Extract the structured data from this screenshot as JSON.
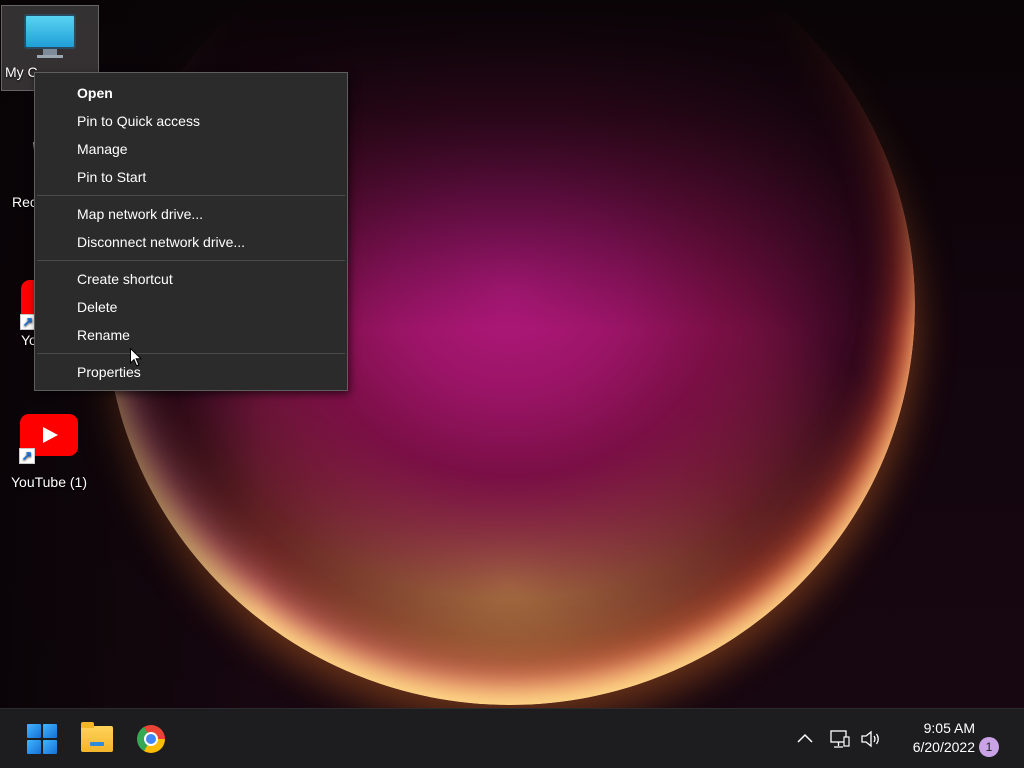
{
  "desktop": {
    "icons": [
      {
        "label": "My C",
        "icon": "monitor-icon"
      },
      {
        "label": "Rec",
        "icon": "recycle-bin-icon"
      },
      {
        "label": "Yo",
        "icon": "youtube-icon"
      },
      {
        "label": "YouTube (1)",
        "icon": "youtube-icon"
      }
    ]
  },
  "context_menu": {
    "items": [
      {
        "label": "Open",
        "bold": true
      },
      {
        "label": "Pin to Quick access"
      },
      {
        "label": "Manage"
      },
      {
        "label": "Pin to Start"
      },
      {
        "label": "Map network drive..."
      },
      {
        "label": "Disconnect network drive..."
      },
      {
        "label": "Create shortcut"
      },
      {
        "label": "Delete"
      },
      {
        "label": "Rename"
      },
      {
        "label": "Properties"
      }
    ]
  },
  "taskbar": {
    "pinned": [
      {
        "icon": "windows-start-icon"
      },
      {
        "icon": "file-explorer-icon"
      },
      {
        "icon": "chrome-icon"
      }
    ],
    "tray": {
      "icons": [
        "chevron-up-icon",
        "network-icon",
        "volume-icon"
      ],
      "time": "9:05 AM",
      "date": "6/20/2022",
      "notification_count": "1"
    }
  },
  "colors": {
    "menu_bg": "#2b2b2b",
    "taskbar_bg": "#1d1d1f",
    "accent": "#1670d6"
  }
}
